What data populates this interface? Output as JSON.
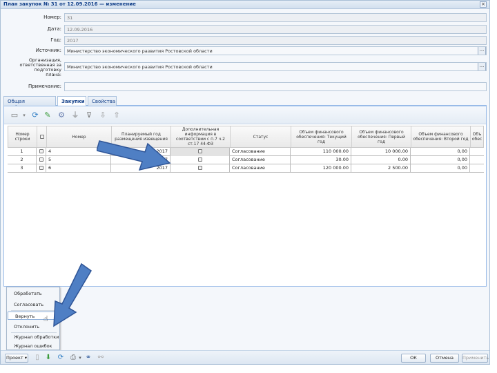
{
  "window": {
    "title": "План закупок № 31 от 12.09.2016 — изменение",
    "close": "×"
  },
  "form": {
    "number_label": "Номер:",
    "number_value": "31",
    "date_label": "Дата:",
    "date_value": "12.09.2016",
    "year_label": "Год:",
    "year_value": "2017",
    "sources_label": "Источник:",
    "sources_value": "Министерство экономического развития Ростовской области",
    "org_label_1": "Организация,",
    "org_label_2": "ответственная за подготовку",
    "org_label_3": "плана:",
    "org_value": "Министерство экономического развития Ростовской области",
    "note_label": "Примечание:",
    "note_value": "",
    "lookup": "..."
  },
  "tabs": [
    {
      "label": "Общая информация"
    },
    {
      "label": "Закупки"
    },
    {
      "label": "Свойства"
    }
  ],
  "toolbar_icons": [
    "add-icon",
    "refresh-icon",
    "edit-icon",
    "settings-icon",
    "filter-icon",
    "filter-clear-icon",
    "move-down-icon",
    "move-up-icon"
  ],
  "grid": {
    "columns": [
      "Номер строки",
      "",
      "Номер",
      "Планируемый год размещения извещения",
      "Дополнительная информация в соответствии с п.7 ч.2 ст.17 44-ФЗ",
      "Статус",
      "Объем финансового обеспечения: Текущий год",
      "Объем финансового обеспечения: Первый год",
      "Объем финансового обеспечения: Второй год",
      "Объ обес"
    ],
    "rows": [
      {
        "line": "1",
        "number": "4",
        "year": "2017",
        "status": "Согласование",
        "cur": "110 000.00",
        "first": "10 000.00",
        "second": "0,00"
      },
      {
        "line": "2",
        "number": "5",
        "year": "2017",
        "status": "Согласование",
        "cur": "30.00",
        "first": "0.00",
        "second": "0,00"
      },
      {
        "line": "3",
        "number": "6",
        "year": "2017",
        "status": "Согласование",
        "cur": "120 000.00",
        "first": "2 500.00",
        "second": "0,00"
      }
    ]
  },
  "context_menu": {
    "items": [
      "Обработать",
      "Согласовать",
      "Вернуть",
      "Отклонить",
      "Журнал обработки",
      "Журнал ошибок"
    ],
    "highlighted": "Вернуть"
  },
  "bottom": {
    "project_button": "Проект ▾",
    "ok": "ОК",
    "cancel": "Отмена",
    "apply": "Применить"
  },
  "colors": {
    "arrow": "#4f7fc4",
    "arrow_border": "#2f5597",
    "tab_text": "#15428b"
  }
}
